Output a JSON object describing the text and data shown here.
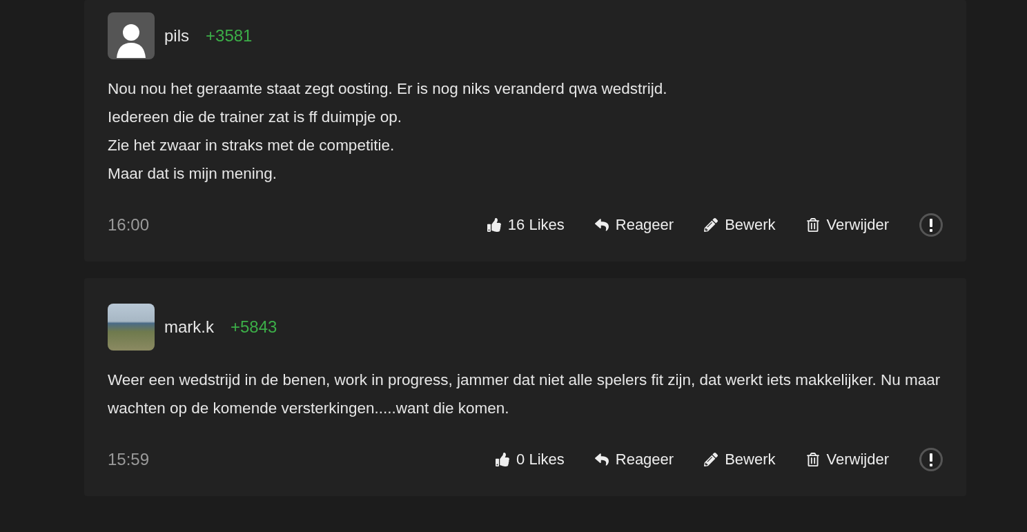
{
  "comments": [
    {
      "author": "pils",
      "score": "+3581",
      "avatar": {
        "kind": "default"
      },
      "lines": [
        "Nou nou het geraamte staat zegt oosting. Er is nog niks veranderd qwa wedstrijd.",
        "Iedereen die de trainer zat is ff duimpje op.",
        "Zie het zwaar in straks met de competitie.",
        "Maar dat is mijn mening."
      ],
      "time": "16:00",
      "likes": "16 Likes",
      "actions": [
        "Reageer",
        "Bewerk",
        "Verwijder"
      ]
    },
    {
      "author": "mark.k",
      "score": "+5843",
      "avatar": {
        "kind": "photo"
      },
      "lines": [
        "Weer een wedstrijd in de benen, work in progress, jammer dat niet alle spelers fit zijn, dat werkt iets makkelijker. Nu maar wachten op de komende versterkingen.....want die komen."
      ],
      "time": "15:59",
      "likes": "0 Likes",
      "actions": [
        "Reageer",
        "Bewerk",
        "Verwijder"
      ]
    }
  ]
}
